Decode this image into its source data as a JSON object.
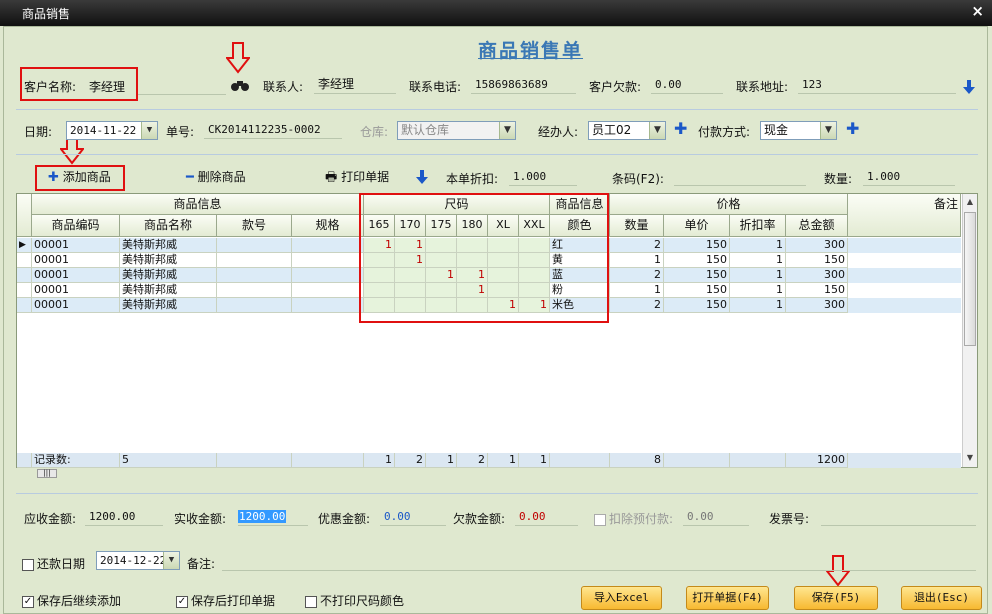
{
  "window": {
    "title": "商品销售",
    "close": "×"
  },
  "form_title": "商品销售单",
  "header": {
    "customer_label": "客户名称:",
    "customer_value": "李经理",
    "contact_label": "联系人:",
    "contact_value": "李经理",
    "phone_label": "联系电话:",
    "phone_value": "15869863689",
    "owed_label": "客户欠款:",
    "owed_value": "0.00",
    "address_label": "联系地址:",
    "address_value": "123"
  },
  "row2": {
    "date_label": "日期:",
    "date_value": "2014-11-22",
    "order_label": "单号:",
    "order_value": "CK2014112235-0002",
    "warehouse_label": "仓库:",
    "warehouse_value": "默认仓库",
    "handler_label": "经办人:",
    "handler_value": "员工02",
    "pay_label": "付款方式:",
    "pay_value": "现金"
  },
  "toolbar": {
    "add": "添加商品",
    "delete": "删除商品",
    "print": "打印单据",
    "discount_label": "本单折扣:",
    "discount_value": "1.000",
    "barcode_label": "条码(F2):",
    "qty_label": "数量:",
    "qty_value": "1.000"
  },
  "grid": {
    "groups": {
      "info": "商品信息",
      "size": "尺码",
      "info2": "商品信息",
      "price": "价格",
      "remark": "备注"
    },
    "cols": {
      "code": "商品编码",
      "name": "商品名称",
      "style": "款号",
      "spec": "规格",
      "s1": "165",
      "s2": "170",
      "s3": "175",
      "s4": "180",
      "s5": "XL",
      "s6": "XXL",
      "color": "颜色",
      "qty": "数量",
      "price": "单价",
      "rate": "折扣率",
      "total": "总金额"
    },
    "rows": [
      {
        "code": "00001",
        "name": "美特斯邦威",
        "s1": "1",
        "s2": "1",
        "s3": "",
        "s4": "",
        "s5": "",
        "s6": "",
        "color": "红",
        "qty": "2",
        "price": "150",
        "rate": "1",
        "total": "300"
      },
      {
        "code": "00001",
        "name": "美特斯邦威",
        "s1": "",
        "s2": "1",
        "s3": "",
        "s4": "",
        "s5": "",
        "s6": "",
        "color": "黄",
        "qty": "1",
        "price": "150",
        "rate": "1",
        "total": "150"
      },
      {
        "code": "00001",
        "name": "美特斯邦威",
        "s1": "",
        "s2": "",
        "s3": "1",
        "s4": "1",
        "s5": "",
        "s6": "",
        "color": "蓝",
        "qty": "2",
        "price": "150",
        "rate": "1",
        "total": "300"
      },
      {
        "code": "00001",
        "name": "美特斯邦威",
        "s1": "",
        "s2": "",
        "s3": "",
        "s4": "1",
        "s5": "",
        "s6": "",
        "color": "粉",
        "qty": "1",
        "price": "150",
        "rate": "1",
        "total": "150"
      },
      {
        "code": "00001",
        "name": "美特斯邦威",
        "s1": "",
        "s2": "",
        "s3": "",
        "s4": "",
        "s5": "1",
        "s6": "1",
        "color": "米色",
        "qty": "2",
        "price": "150",
        "rate": "1",
        "total": "300"
      }
    ],
    "footer": {
      "label": "记录数:",
      "count": "5",
      "s1": "1",
      "s2": "2",
      "s3": "1",
      "s4": "2",
      "s5": "1",
      "s6": "1",
      "qty": "8",
      "total": "1200"
    }
  },
  "summary": {
    "receivable_label": "应收金额:",
    "receivable_value": "1200.00",
    "received_label": "实收金额:",
    "received_value": "1200.00",
    "discount_label": "优惠金额:",
    "discount_value": "0.00",
    "debt_label": "欠款金额:",
    "debt_value": "0.00",
    "prepay_label": "扣除预付款:",
    "prepay_value": "0.00",
    "invoice_label": "发票号:"
  },
  "repay": {
    "label": "还款日期",
    "date": "2014-12-22",
    "remark_label": "备注:"
  },
  "options": {
    "continue": "保存后继续添加",
    "print_after": "保存后打印单据",
    "no_size_color": "不打印尺码颜色"
  },
  "buttons": {
    "excel": "导入Excel",
    "open": "打开单据(F4)",
    "save": "保存(F5)",
    "exit": "退出(Esc)"
  },
  "colors": {
    "accent": "#1b58c8",
    "annotation": "#e01010",
    "title_blue": "#3a78b5"
  }
}
